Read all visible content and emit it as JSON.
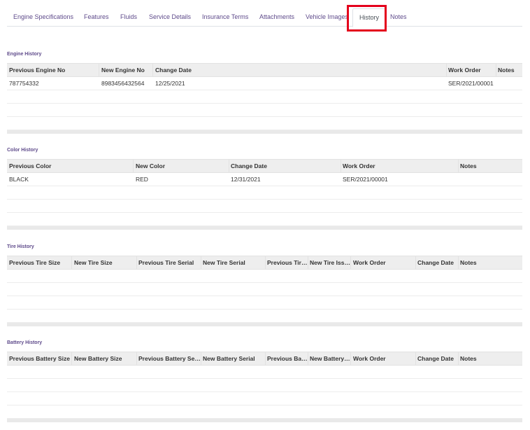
{
  "tabs": [
    {
      "label": "Engine Specifications"
    },
    {
      "label": "Features"
    },
    {
      "label": "Fluids"
    },
    {
      "label": "Service Details"
    },
    {
      "label": "Insurance Terms"
    },
    {
      "label": "Attachments"
    },
    {
      "label": "Vehicle Images"
    },
    {
      "label": "History"
    },
    {
      "label": "Notes"
    }
  ],
  "active_tab": "History",
  "highlight_color": "#e4001c",
  "engine": {
    "title": "Engine History",
    "columns": [
      "Previous Engine No",
      "New Engine No",
      "Change Date",
      "Work Order",
      "Notes"
    ],
    "rows": [
      [
        "787754332",
        "8983456432564",
        "12/25/2021",
        "SER/2021/00001",
        ""
      ]
    ]
  },
  "color": {
    "title": "Color History",
    "columns": [
      "Previous Color",
      "New Color",
      "Change Date",
      "Work Order",
      "Notes"
    ],
    "rows": [
      [
        "BLACK",
        "RED",
        "12/31/2021",
        "SER/2021/00001",
        ""
      ]
    ]
  },
  "tire": {
    "title": "Tire History",
    "columns": [
      "Previous Tire Size",
      "New Tire Size",
      "Previous Tire Serial",
      "New Tire Serial",
      "Previous Tire Issue",
      "New Tire Issue",
      "Work Order",
      "Change Date",
      "Notes"
    ]
  },
  "battery": {
    "title": "Battery History",
    "columns": [
      "Previous Battery Size",
      "New Battery Size",
      "Previous Battery Serial",
      "New Battery Serial",
      "Previous Battery Issue",
      "New Battery Issue",
      "Work Order",
      "Change Date",
      "Notes"
    ]
  }
}
